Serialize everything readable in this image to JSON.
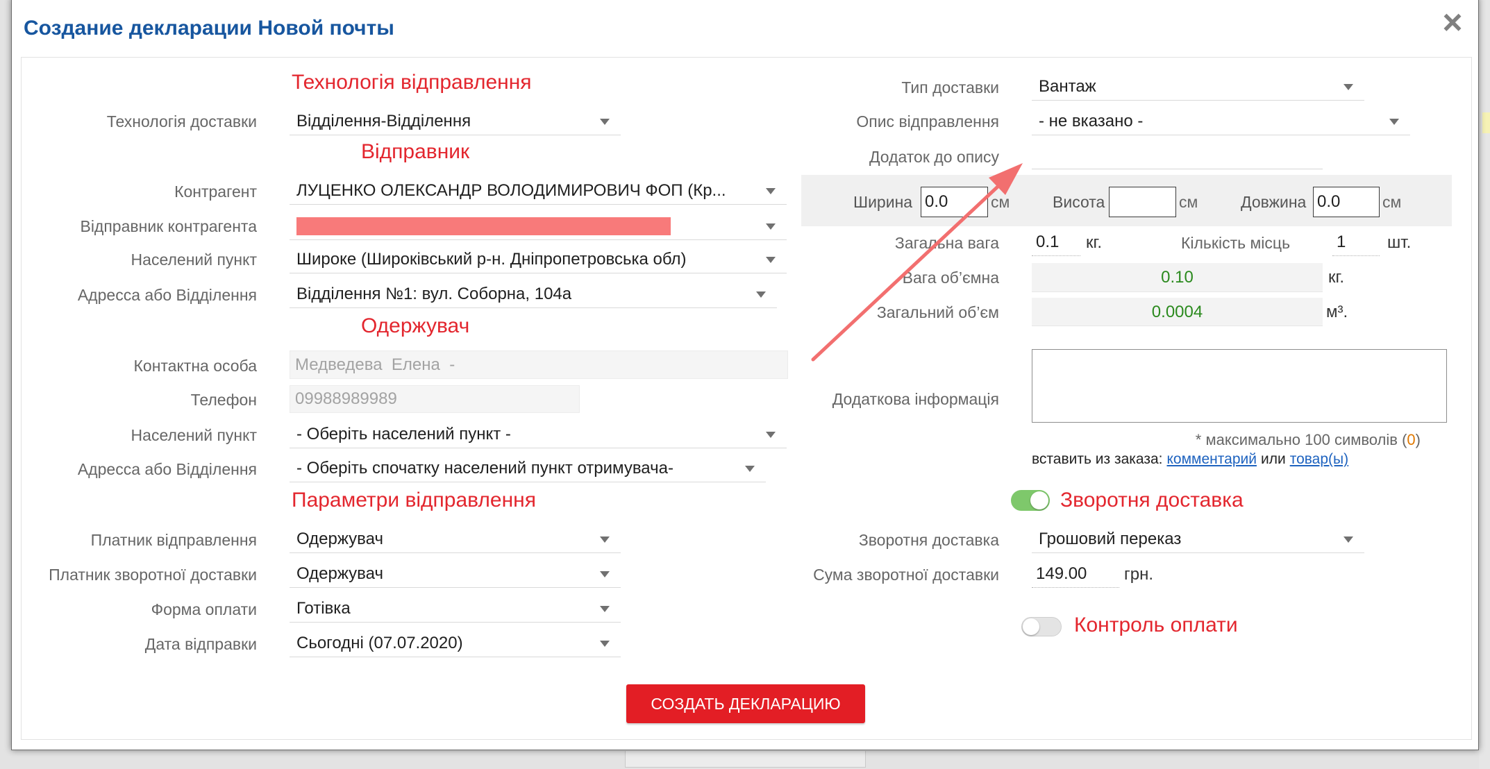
{
  "modal": {
    "title": "Создание декларации Новой почты",
    "close_label": "×"
  },
  "technology": {
    "section": "Технологія відправлення",
    "delivery_technology": {
      "label": "Технологія доставки",
      "value": "Відділення-Відділення"
    }
  },
  "sender": {
    "section": "Відправник",
    "counterparty": {
      "label": "Контрагент",
      "value": "ЛУЦЕНКО ОЛЕКСАНДР ВОЛОДИМИРОВИЧ ФОП (Кр..."
    },
    "contact": {
      "label": "Відправник контрагента"
    },
    "city": {
      "label": "Населений пункт",
      "value": "Широке (Широківський р-н. Дніпропетровська обл)"
    },
    "address": {
      "label": "Адресса або Відділення",
      "value": "Відділення №1: вул. Соборна, 104а"
    }
  },
  "recipient": {
    "section": "Одержувач",
    "contact_person": {
      "label": "Контактна особа",
      "value": "Медведева  Елена  -"
    },
    "phone": {
      "label": "Телефон",
      "value": "09988989989"
    },
    "city": {
      "label": "Населений пункт",
      "value": "- Оберіть населений пункт -"
    },
    "address": {
      "label": "Адресса або Відділення",
      "value": "- Оберіть спочатку населений пункт отримувача-"
    }
  },
  "params": {
    "section": "Параметри відправлення",
    "payer": {
      "label": "Платник відправлення",
      "value": "Одержувач"
    },
    "return_payer": {
      "label": "Платник зворотної доставки",
      "value": "Одержувач"
    },
    "payment_form": {
      "label": "Форма оплати",
      "value": "Готівка"
    },
    "send_date": {
      "label": "Дата відправки",
      "value": "Сьогодні (07.07.2020)"
    }
  },
  "shipment": {
    "delivery_type": {
      "label": "Тип доставки",
      "value": "Вантаж"
    },
    "description": {
      "label": "Опис відправлення",
      "value": "- не вказано -"
    },
    "description_addon": {
      "label": "Додаток до опису",
      "value": ""
    },
    "width": {
      "label": "Ширина",
      "value": "0.0",
      "unit": "см"
    },
    "height": {
      "label": "Висота",
      "value": "",
      "unit": "см"
    },
    "length": {
      "label": "Довжина",
      "value": "0.0",
      "unit": "см"
    },
    "total_weight": {
      "label": "Загальна вага",
      "value": "0.1",
      "unit": "кг."
    },
    "places": {
      "label": "Кількість місць",
      "value": "1",
      "unit": "шт."
    },
    "volume_weight": {
      "label": "Вага об’ємна",
      "value": "0.10",
      "unit": "кг."
    },
    "total_volume": {
      "label": "Загальний об’єм",
      "value": "0.0004",
      "unit": "м³."
    },
    "extra_info": {
      "label": "Додаткова інформація",
      "value": "",
      "limit_prefix": "* максимально 100 символів (",
      "limit_count": "0",
      "limit_suffix": ")"
    },
    "insert_from_order": {
      "prefix": "вставить из заказа:",
      "comment_link": "комментарий",
      "or": "или",
      "goods_link": "товар(ы)"
    }
  },
  "return_delivery": {
    "section": "Зворотня доставка",
    "enabled": true,
    "type": {
      "label": "Зворотня доставка",
      "value": "Грошовий переказ"
    },
    "amount": {
      "label": "Сума зворотної доставки",
      "value": "149.00",
      "unit": "грн."
    }
  },
  "payment_control": {
    "section": "Контроль оплати",
    "enabled": false
  },
  "submit": {
    "label": "СОЗДАТЬ ДЕКЛАРАЦИЮ"
  },
  "icons": {
    "select_arrow": "chevron-down-icon",
    "close": "close-icon",
    "toggle": "toggle-switch"
  },
  "colors": {
    "title": "#17569f",
    "section": "#e3262e",
    "label": "#666666",
    "value": "#1f1f1f",
    "green": "#2b8a1e",
    "link": "#1d62bf",
    "counter": "#e07800",
    "button": "#e31e25",
    "toggle_on": "#7ec86b",
    "annotation_arrow": "#f26f6f",
    "redaction": "#f87a7a"
  }
}
